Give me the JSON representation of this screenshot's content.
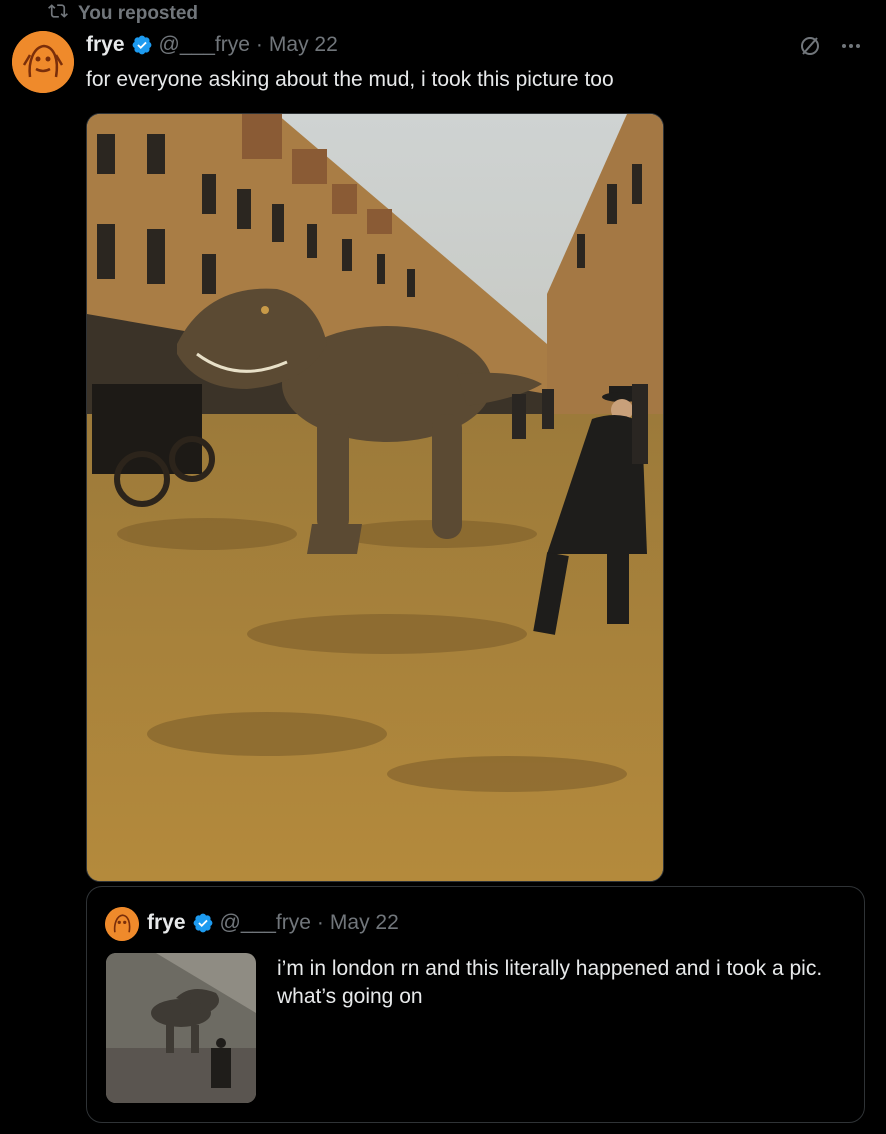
{
  "repost": {
    "label": "You reposted",
    "icon": "repost-icon"
  },
  "tweet": {
    "author_name": "frye",
    "handle": "@___frye",
    "separator": "·",
    "date": "May 22",
    "text": "for everyone asking about the mud, i took this picture too",
    "media_alt": "dinosaur in muddy victorian london street",
    "verified_color": "#1d9bf0"
  },
  "quoted": {
    "author_name": "frye",
    "handle": "@___frye",
    "separator": "·",
    "date": "May 22",
    "text": "i’m in london rn and this literally happened and i took a pic. what’s going on"
  },
  "icons": [
    "grok-icon",
    "more-icon",
    "verified-badge-icon",
    "avatar"
  ]
}
